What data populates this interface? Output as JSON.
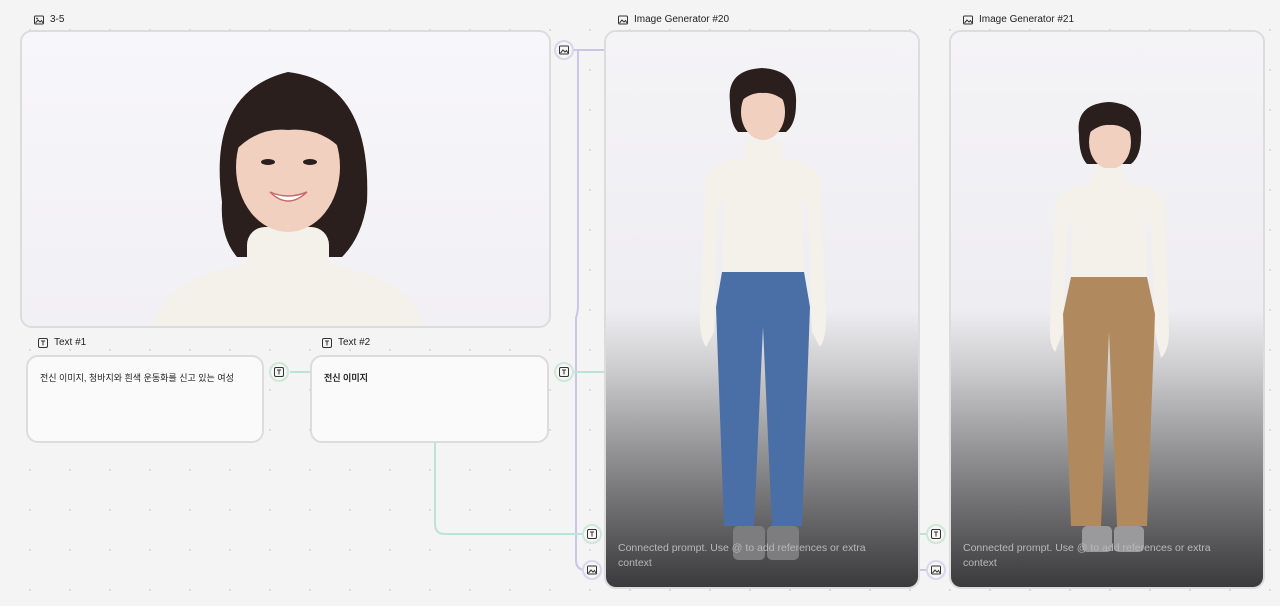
{
  "nodes": {
    "image": {
      "title": "3-5"
    },
    "text1": {
      "title": "Text #1",
      "content": "전신 이미지, 청바지와 흰색 운동화를 신고 있는 여성"
    },
    "text2": {
      "title": "Text #2",
      "content": "전신 이미지"
    },
    "gen20": {
      "title": "Image Generator #20",
      "prompt": "Connected prompt. Use @ to add references or extra context"
    },
    "gen21": {
      "title": "Image Generator #21",
      "prompt": "Connected prompt. Use @ to add references or extra context"
    }
  },
  "icons": {
    "image": "image-icon",
    "text": "text-icon"
  },
  "colors": {
    "wire_purple": "#c9c6e6",
    "wire_green": "#bfe3d1",
    "jeans": "#4a6ea6",
    "khaki": "#b08a5e",
    "sweater": "#f4f1ea",
    "hair": "#2a1f1c"
  }
}
